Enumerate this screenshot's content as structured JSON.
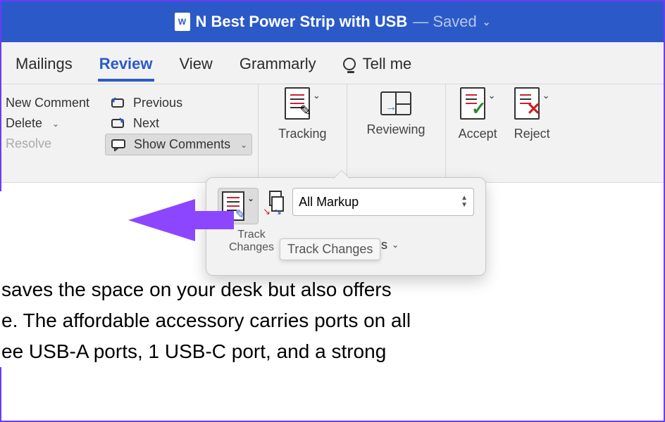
{
  "title": {
    "doc_name": "N Best Power Strip with USB",
    "saved_label": "— Saved"
  },
  "tabs": {
    "mailings": "Mailings",
    "review": "Review",
    "view": "View",
    "grammarly": "Grammarly",
    "tellme": "Tell me"
  },
  "ribbon": {
    "new_comment": "New Comment",
    "delete": "Delete",
    "resolve": "Resolve",
    "previous": "Previous",
    "next": "Next",
    "show_comments": "Show Comments",
    "tracking": "Tracking",
    "reviewing": "Reviewing",
    "accept": "Accept",
    "reject": "Reject"
  },
  "popover": {
    "track_changes_label_line1": "Track",
    "track_changes_label_line2": "Changes",
    "markup_mode": "All Markup",
    "markup_options": "Markup Options",
    "tooltip": "Track Changes"
  },
  "document": {
    "line1": "saves the space on your desk but also offers",
    "line2": "e. The affordable accessory carries ports on all",
    "line3": "ee USB-A ports, 1 USB-C port, and a strong"
  },
  "colors": {
    "accent": "#2b5ac8",
    "annotation_arrow": "#8d46ff"
  }
}
